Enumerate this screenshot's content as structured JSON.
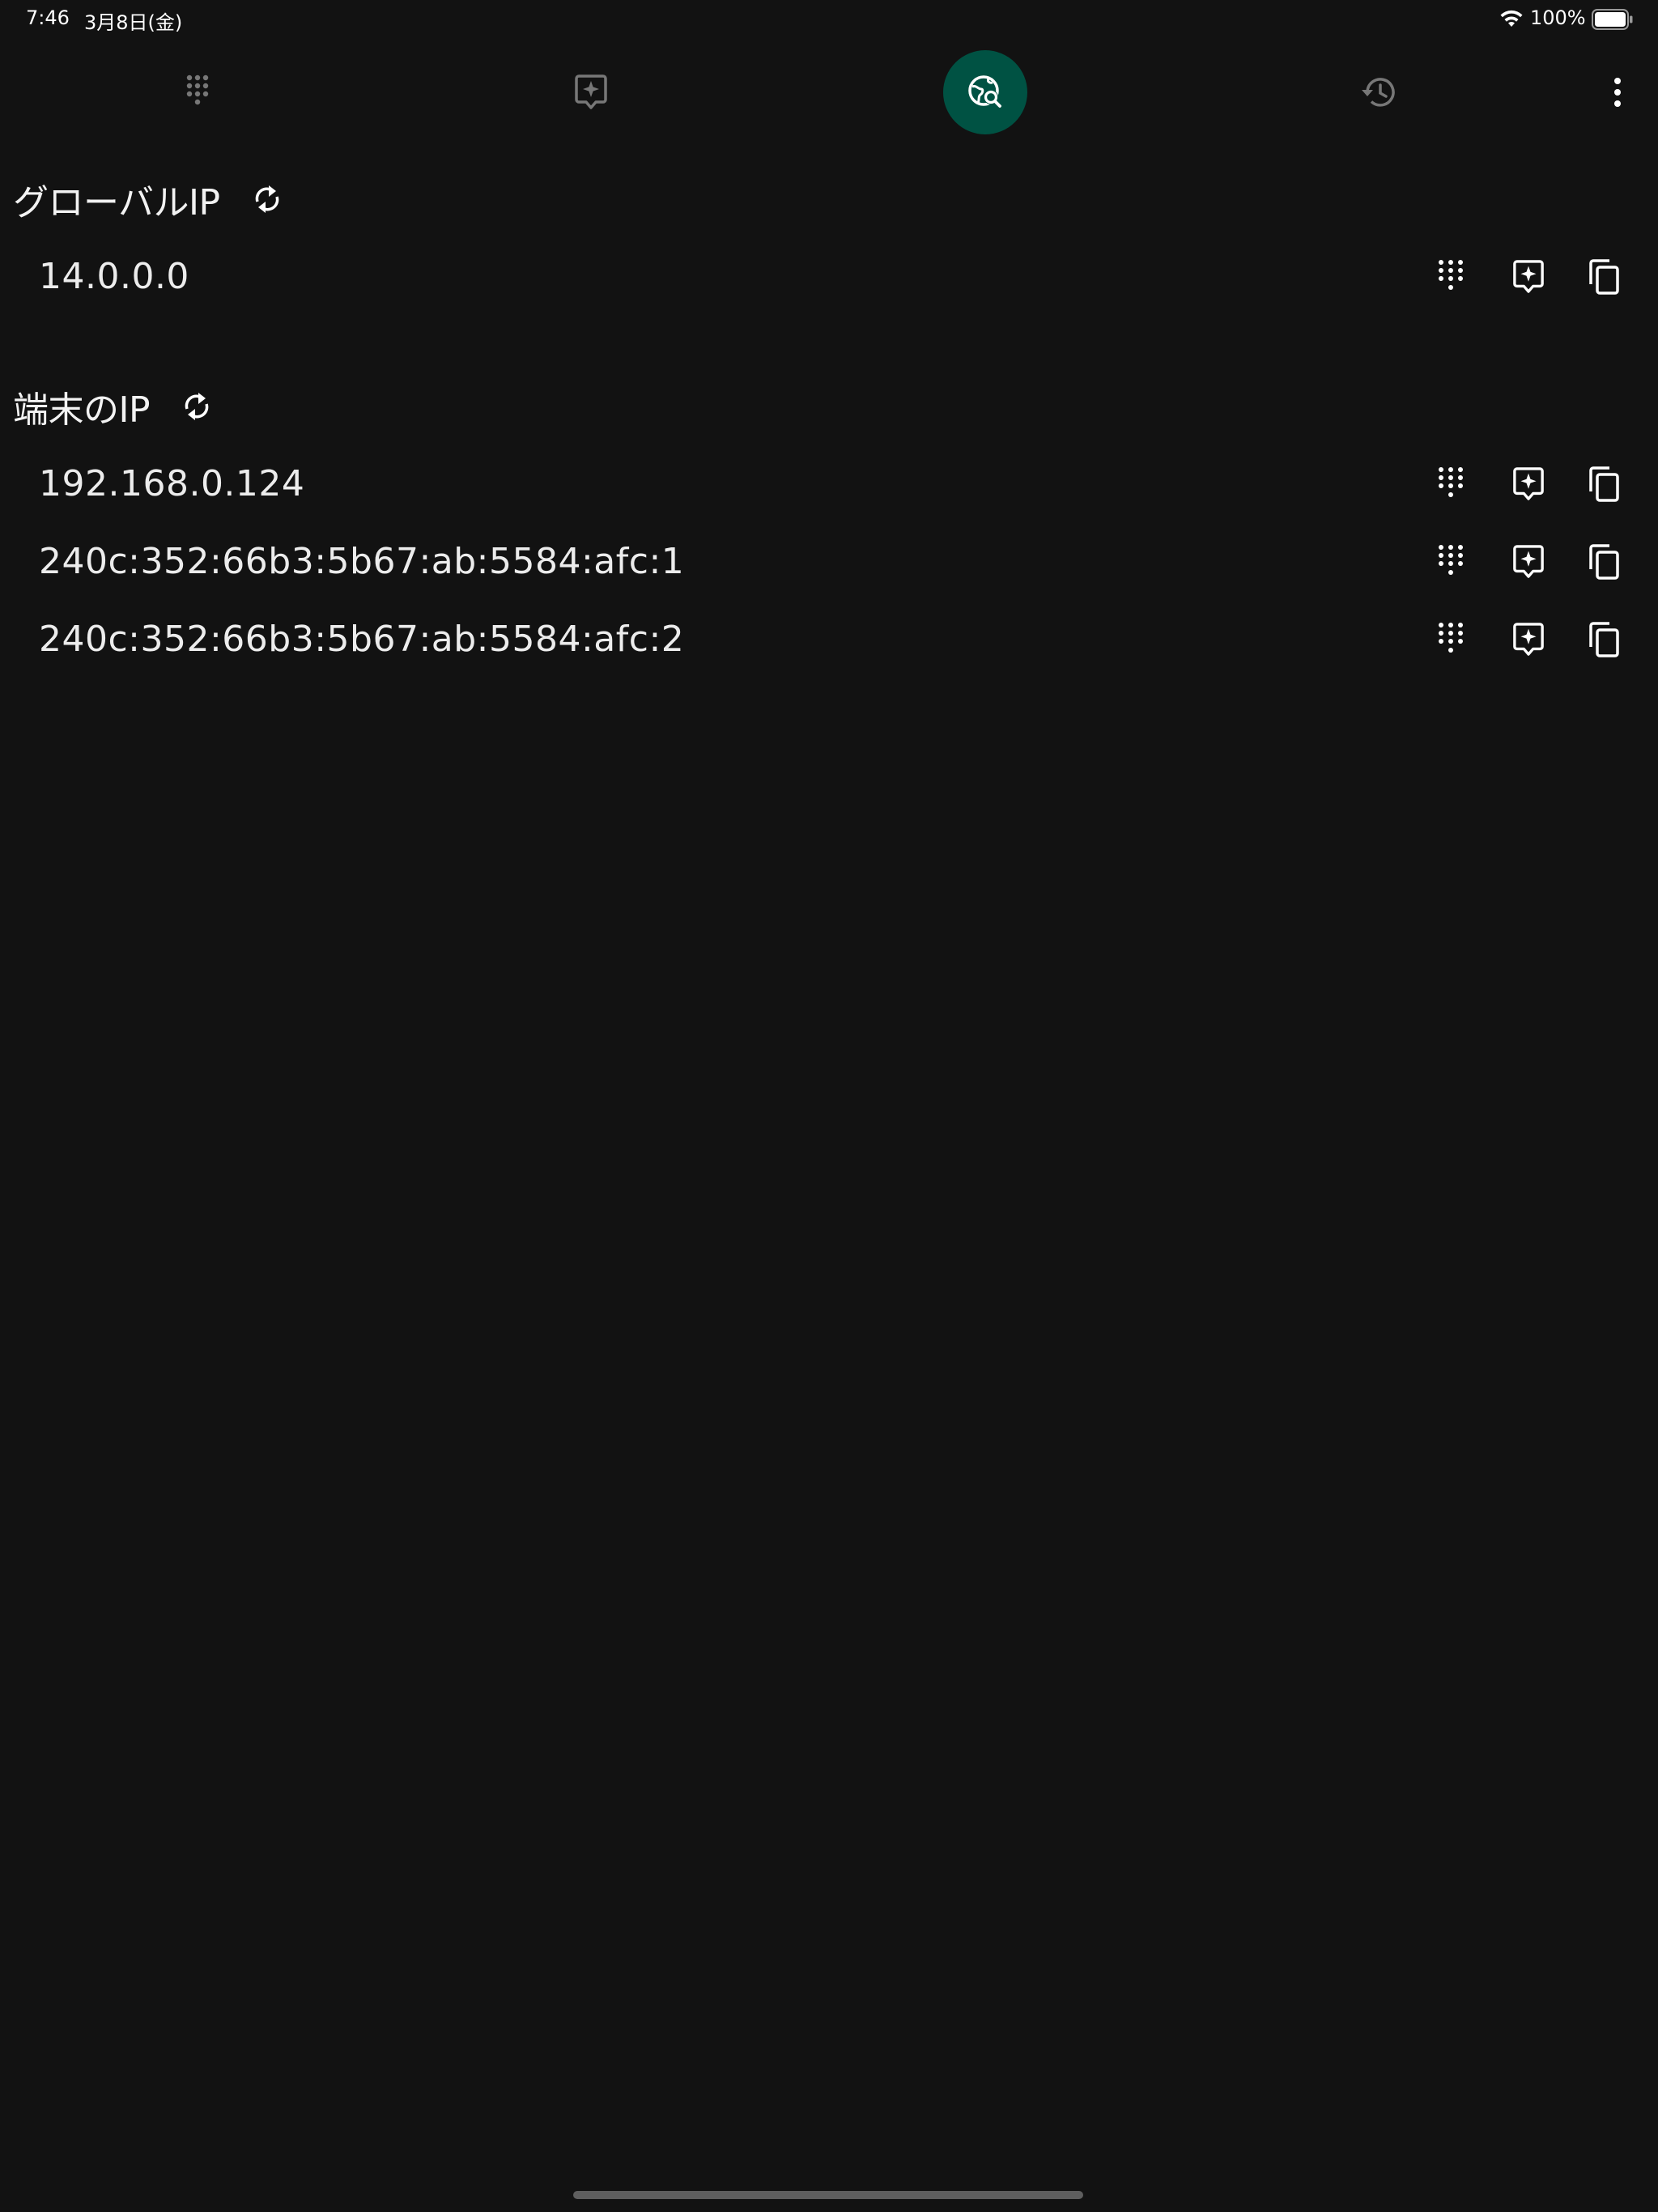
{
  "status_bar": {
    "time": "7:46",
    "date": "3月8日(金)",
    "battery": "100%"
  },
  "top_nav": {
    "items": [
      {
        "icon": "dialpad-icon",
        "active": false
      },
      {
        "icon": "spark-icon",
        "active": false
      },
      {
        "icon": "globe-search-icon",
        "active": true
      },
      {
        "icon": "history-icon",
        "active": false
      },
      {
        "icon": "more-vert-icon",
        "active": false
      }
    ],
    "active_color": "#005243"
  },
  "global_ip": {
    "title": "グローバルIP",
    "addresses": [
      "14.0.0.0"
    ]
  },
  "device_ip": {
    "title": "端末のIP",
    "addresses": [
      "192.168.0.124",
      "240c:352:66b3:5b67:ab:5584:afc:1",
      "240c:352:66b3:5b67:ab:5584:afc:2"
    ]
  },
  "row_actions": [
    "dialpad-icon",
    "spark-icon",
    "copy-icon"
  ]
}
